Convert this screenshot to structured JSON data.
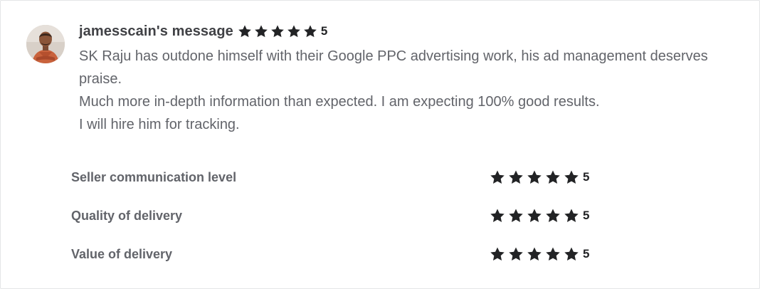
{
  "review": {
    "author_label": "jamesscain's message",
    "rating": "5",
    "star_count": 5,
    "paragraphs": [
      "SK Raju has outdone himself with their Google PPC advertising work, his ad management deserves praise.",
      "Much more in-depth information than expected. I am expecting 100% good results.",
      "I will hire him for tracking."
    ]
  },
  "breakdown": [
    {
      "label": "Seller communication level",
      "rating": "5",
      "star_count": 5
    },
    {
      "label": "Quality of delivery",
      "rating": "5",
      "star_count": 5
    },
    {
      "label": "Value of delivery",
      "rating": "5",
      "star_count": 5
    }
  ],
  "icons": {
    "star": "star-icon",
    "avatar": "user-avatar"
  },
  "colors": {
    "star": "#222325",
    "author_text": "#404145",
    "body_text": "#62646a",
    "border": "#e4e5e7"
  }
}
